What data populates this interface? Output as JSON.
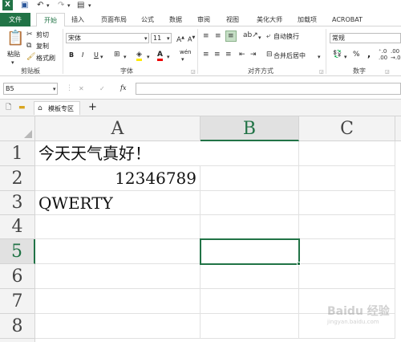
{
  "titlebar": {
    "icons": [
      "excel-logo-icon",
      "save-icon",
      "undo-icon",
      "redo-icon",
      "customize-icon"
    ]
  },
  "tabs": [
    "文件",
    "开始",
    "插入",
    "页面布局",
    "公式",
    "数据",
    "审阅",
    "视图",
    "美化大师",
    "加载项",
    "ACROBAT"
  ],
  "clipboard": {
    "paste": "粘贴",
    "cut": "剪切",
    "copy": "复制",
    "format_painter": "格式刷",
    "group": "剪贴板"
  },
  "font": {
    "name": "宋体",
    "size": "11",
    "group": "字体",
    "bold": "B",
    "italic": "I",
    "underline": "U",
    "wen": "wén"
  },
  "alignment": {
    "wrap": "自动换行",
    "merge": "合并后居中",
    "group": "对齐方式"
  },
  "number": {
    "format": "常规",
    "group": "数字",
    "percent": "%",
    "comma": ","
  },
  "formula_bar": {
    "name_box": "B5",
    "cancel": "✕",
    "enter": "✓",
    "fx": "fx",
    "value": ""
  },
  "sheetbar": {
    "tab_label": "模板专区",
    "add": "+"
  },
  "columns": [
    "A",
    "B",
    "C"
  ],
  "rows": [
    "1",
    "2",
    "3",
    "4",
    "5",
    "6",
    "7",
    "8"
  ],
  "cells": {
    "A1": "今天天气真好！",
    "A2": "12346789",
    "A3": "QWERTY"
  },
  "selected_cell": "B5",
  "watermark": {
    "line1": "Baidu 经验",
    "line2": "jingyan.baidu.com"
  },
  "colors": {
    "accent": "#217346",
    "header_bg": "#f3f3f3",
    "grid_line": "#e1e1e1"
  }
}
